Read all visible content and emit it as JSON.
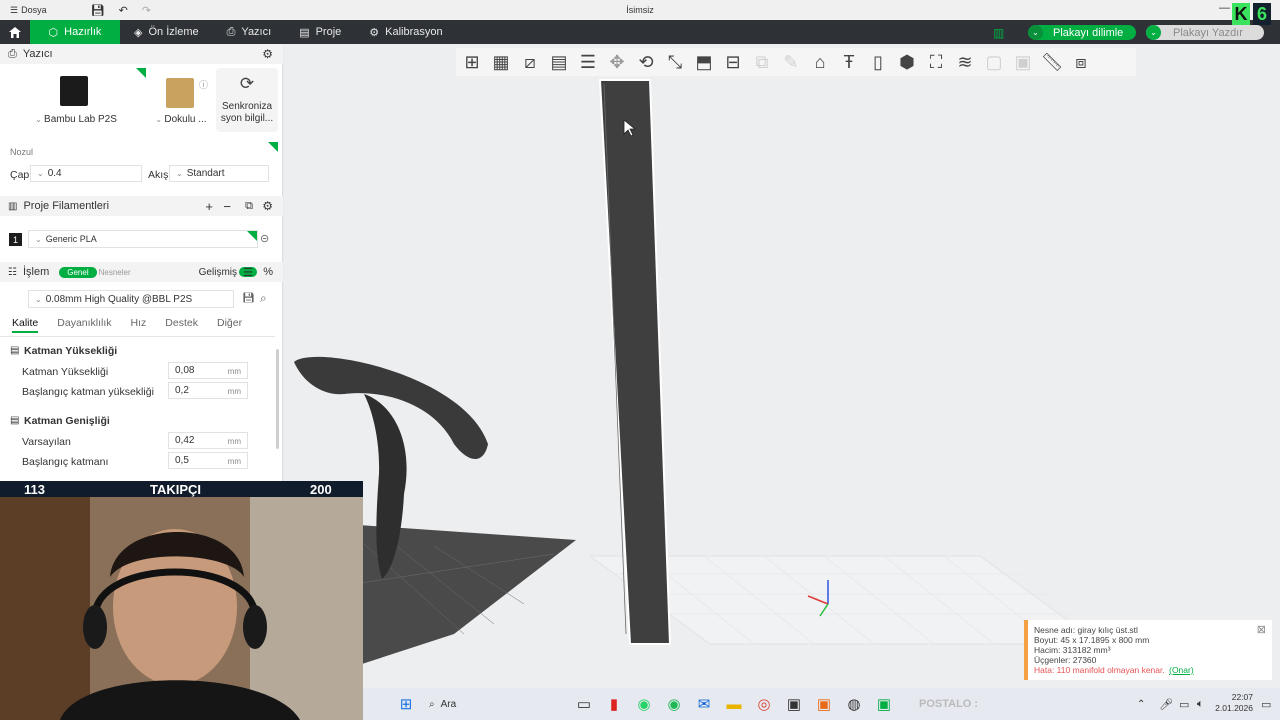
{
  "titlebar": {
    "file_menu": "Dosya",
    "window_title": "İsimsiz"
  },
  "nav": {
    "tabs": [
      {
        "label": "Hazırlık",
        "icon": "hazirlik-icon"
      },
      {
        "label": "Ön İzleme",
        "icon": "preview-icon"
      },
      {
        "label": "Yazıcı",
        "icon": "printer-icon"
      },
      {
        "label": "Proje",
        "icon": "project-icon"
      },
      {
        "label": "Kalibrasyon",
        "icon": "calibration-icon"
      }
    ],
    "slice_button": "Plakayı dilimle",
    "print_button": "Plakayı Yazdır"
  },
  "brand_badge": {
    "letter": "K",
    "number": "6"
  },
  "printer": {
    "section_title": "Yazıcı",
    "printer_name": "Bambu Lab P2S",
    "plate_name": "Dokulu ...",
    "sync_label": "Senkroniza syon bilgil...",
    "nozzle_title": "Nozul",
    "diameter_label": "Çap",
    "diameter_value": "0.4",
    "flow_label": "Akış",
    "flow_value": "Standart"
  },
  "filaments": {
    "section_title": "Proje Filamentleri",
    "items": [
      {
        "index": "1",
        "name": "Generic PLA"
      }
    ]
  },
  "process": {
    "section_title": "İşlem",
    "toggle_general": "Genel",
    "toggle_objects": "Nesneler",
    "advanced_label": "Gelişmiş",
    "profile": "0.08mm High Quality @BBL P2S",
    "tabs": [
      "Kalite",
      "Dayanıklılık",
      "Hız",
      "Destek",
      "Diğer"
    ],
    "groups": [
      {
        "title": "Katman Yüksekliği",
        "rows": [
          {
            "label": "Katman Yüksekliği",
            "value": "0,08",
            "unit": "mm"
          },
          {
            "label": "Başlangıç katman yüksekliği",
            "value": "0,2",
            "unit": "mm"
          }
        ]
      },
      {
        "title": "Katman Genişliği",
        "rows": [
          {
            "label": "Varsayılan",
            "value": "0,42",
            "unit": "mm"
          },
          {
            "label": "Başlangıç katmanı",
            "value": "0,5",
            "unit": "mm"
          }
        ]
      }
    ]
  },
  "follower_bar": {
    "current": "113",
    "label": "TAKIPÇI",
    "goal": "200"
  },
  "notification": {
    "line1": "Nesne adı: giray kılıç üst.stl",
    "line2": "Boyut: 45 x 17.1895 x 800 mm",
    "line3": "Hacim: 313182 mm³",
    "line4": "Üçgenler: 27360",
    "error": "Hata: 110 manifold olmayan kenar.",
    "fix_link": "(Onar)"
  },
  "taskbar": {
    "search_placeholder": "Ara",
    "overlay_text": "POSTALO :",
    "time": "22:07",
    "date": "2.01.2026"
  },
  "colors": {
    "accent": "#00ae42",
    "dark_nav": "#2e3136",
    "error": "#e55353",
    "warning": "#f5a043"
  }
}
